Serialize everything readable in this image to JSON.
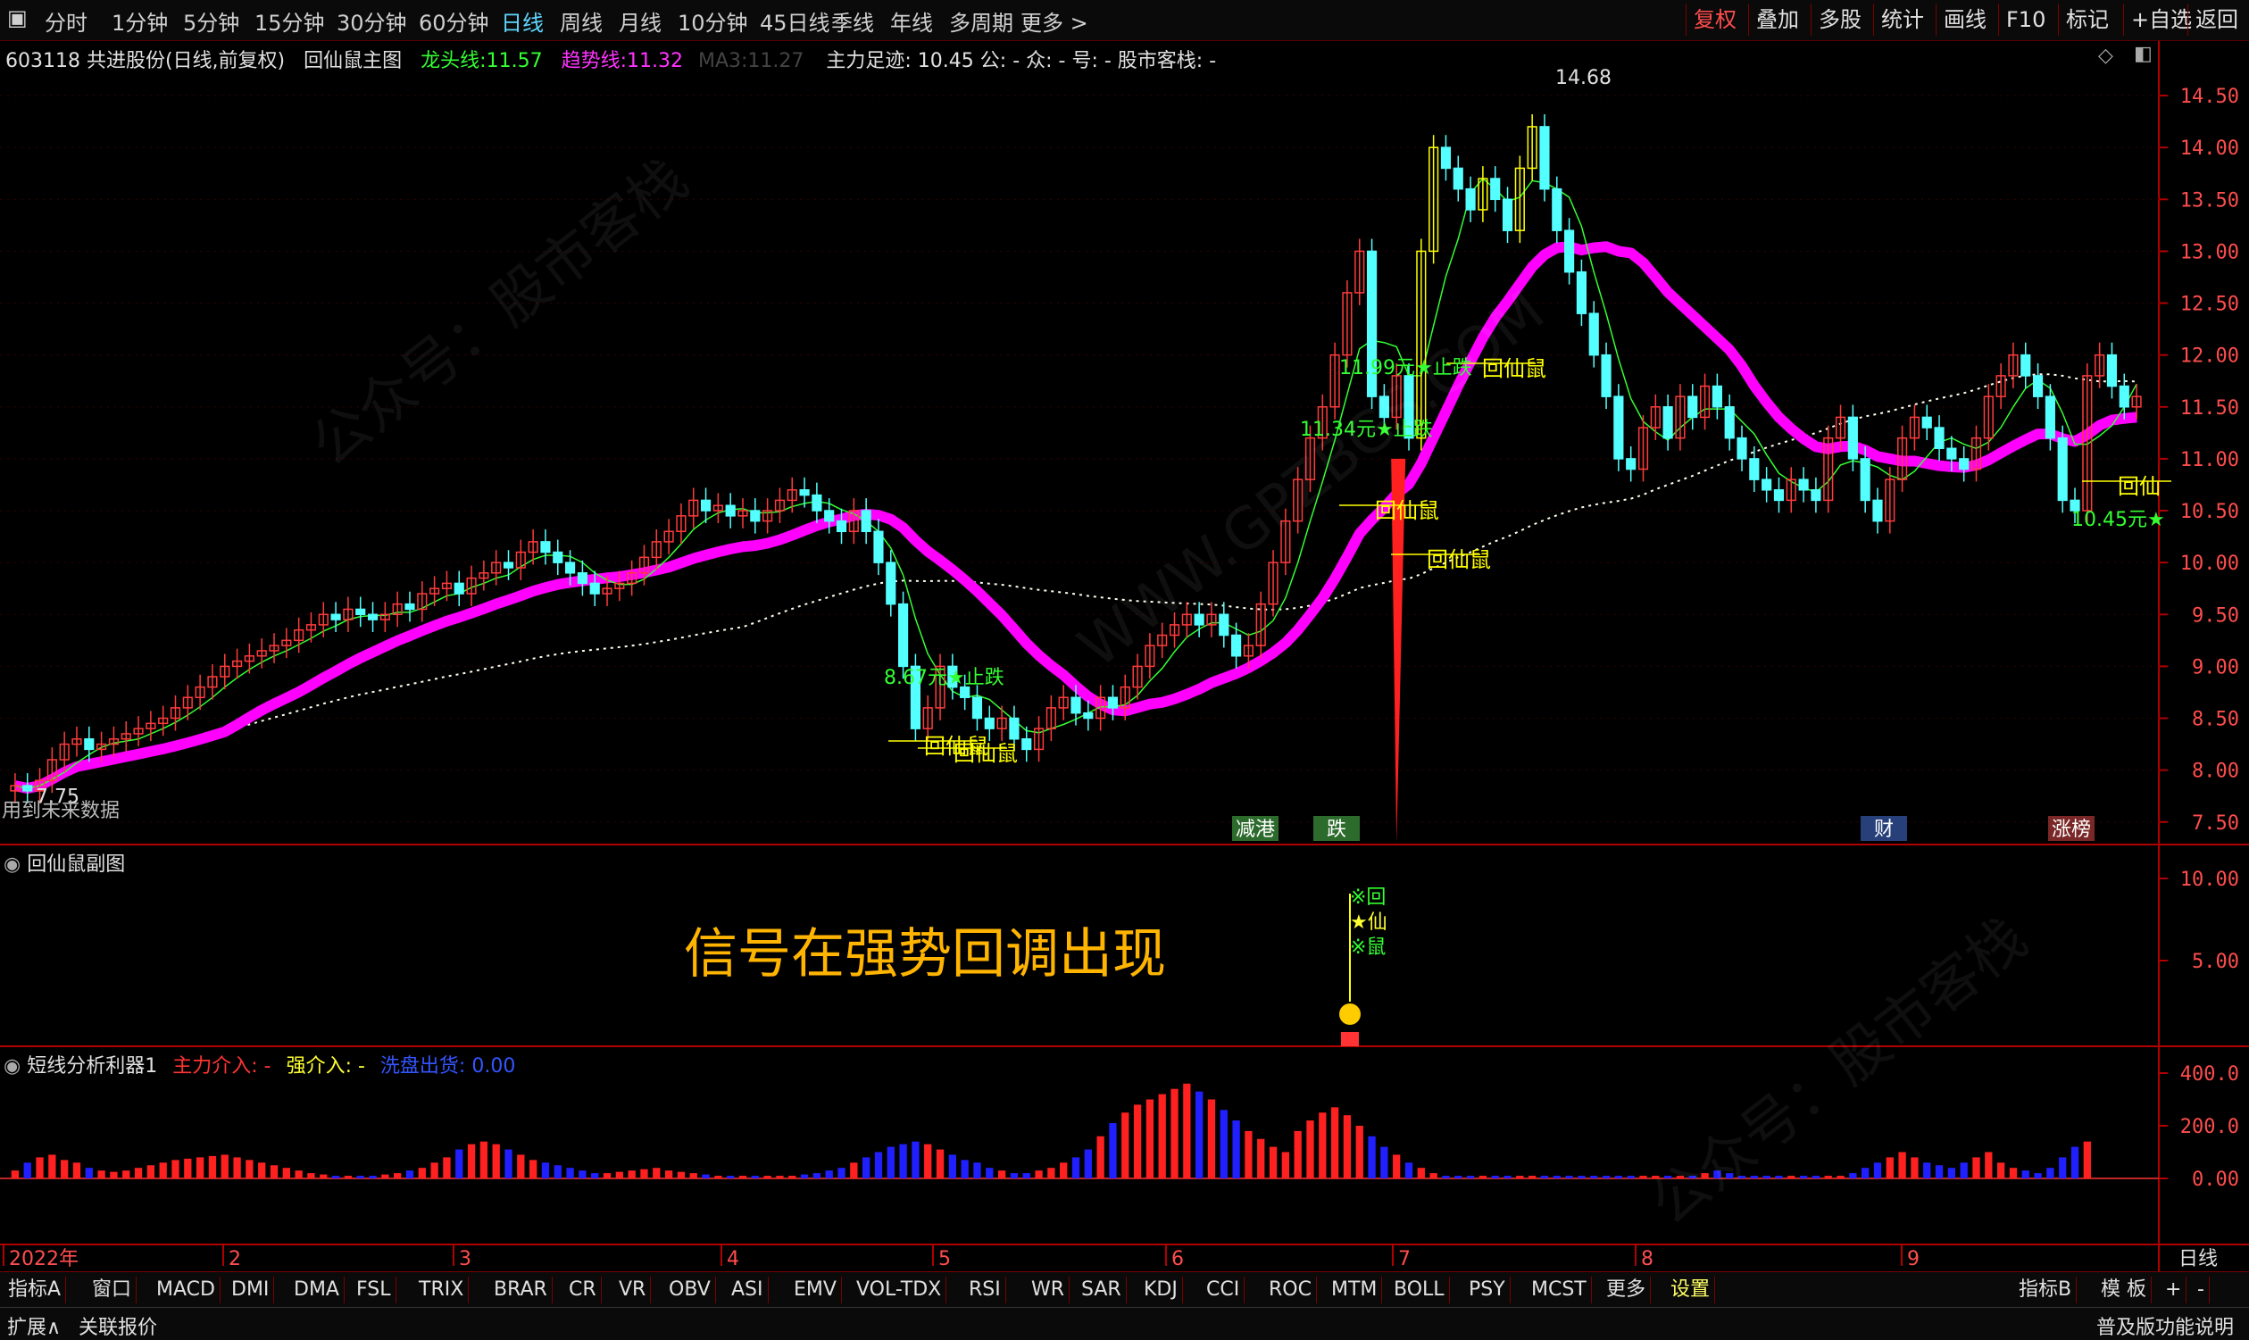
{
  "toolbar": {
    "periods": [
      "分时",
      "1分钟",
      "5分钟",
      "15分钟",
      "30分钟",
      "60分钟",
      "日线",
      "周线",
      "月线",
      "10分钟",
      "45日线",
      "季线",
      "年线",
      "多周期",
      "更多"
    ],
    "active_period": "日线",
    "right_tabs": [
      "复权",
      "叠加",
      "多股",
      "统计",
      "画线",
      "F10",
      "标记",
      "+自选",
      "返回"
    ]
  },
  "main_header": {
    "stock": "603118 共进股份(日线,前复权)",
    "indicator": "回仙鼠主图",
    "dragon_label": "龙头线:",
    "dragon_value": "11.57",
    "trend_label": "趋势线:",
    "trend_value": "11.32",
    "ma3_label": "MA3:",
    "ma3_value": "11.27",
    "footprint": "主力足迹: 10.45 公: - 众: - 号: - 股市客栈: -"
  },
  "sub1_header": {
    "title": "回仙鼠副图"
  },
  "sub2_header": {
    "title": "短线分析利器1",
    "main_in": "主力介入: -",
    "strong_in": "强介入: -",
    "wash": "洗盘出货: 0.00"
  },
  "annotation_note": "信号在强势回调出现",
  "future_note": "用到未来数据",
  "colors": {
    "up": "#ff3b3b",
    "down": "#54ffff",
    "yellow": "#ffff00",
    "magenta": "#ff00ff",
    "green": "#33ff33",
    "blue": "#1a1aff"
  },
  "chart_data": {
    "type": "candlestick",
    "x_months": [
      "2022年",
      "2",
      "3",
      "4",
      "5",
      "6",
      "7",
      "8",
      "9"
    ],
    "y_ticks": [
      7.5,
      8.0,
      8.5,
      9.0,
      9.5,
      10.0,
      10.5,
      11.0,
      11.5,
      12.0,
      12.5,
      13.0,
      13.5,
      14.0,
      14.5
    ],
    "ylim": [
      7.3,
      14.75
    ],
    "high_label": "14.68",
    "low_label": "7.75",
    "event_tags": [
      "减港",
      "跌",
      "财",
      "涨榜"
    ],
    "signal_labels": [
      "回仙鼠",
      "回仙鼠",
      "回仙鼠",
      "回仙鼠",
      "回仙鼠",
      "回仙"
    ],
    "stop_labels": [
      "8.67元★止跌",
      "11.99元★止跌",
      "11.34元★止跌",
      "10.45元★"
    ],
    "sub1_y_ticks": [
      5.0,
      10.0
    ],
    "sub1_signal": [
      "※回",
      "★仙",
      "※鼠"
    ],
    "sub2_y_ticks": [
      0.0,
      200.0,
      400.0
    ],
    "closes": [
      7.85,
      7.8,
      7.9,
      8.1,
      8.25,
      8.3,
      8.2,
      8.25,
      8.3,
      8.35,
      8.4,
      8.45,
      8.5,
      8.6,
      8.7,
      8.8,
      8.9,
      9.0,
      9.05,
      9.1,
      9.15,
      9.2,
      9.25,
      9.35,
      9.4,
      9.5,
      9.45,
      9.55,
      9.5,
      9.45,
      9.5,
      9.6,
      9.55,
      9.7,
      9.75,
      9.8,
      9.7,
      9.85,
      9.9,
      10.0,
      9.95,
      10.1,
      10.2,
      10.1,
      10.0,
      9.9,
      9.8,
      9.7,
      9.75,
      9.8,
      9.9,
      10.05,
      10.2,
      10.3,
      10.45,
      10.6,
      10.5,
      10.55,
      10.45,
      10.5,
      10.4,
      10.5,
      10.6,
      10.7,
      10.65,
      10.5,
      10.4,
      10.3,
      10.5,
      10.3,
      10.0,
      9.6,
      9.0,
      8.4,
      8.6,
      9.0,
      8.8,
      8.7,
      8.5,
      8.4,
      8.5,
      8.3,
      8.2,
      8.4,
      8.6,
      8.7,
      8.55,
      8.5,
      8.7,
      8.6,
      8.8,
      9.0,
      9.2,
      9.3,
      9.4,
      9.5,
      9.4,
      9.5,
      9.3,
      9.1,
      9.2,
      9.6,
      10.0,
      10.4,
      10.8,
      11.2,
      11.5,
      12.0,
      12.6,
      13.0,
      11.6,
      11.4,
      11.8,
      11.2,
      13.0,
      14.0,
      13.8,
      13.6,
      13.4,
      13.7,
      13.5,
      13.2,
      13.8,
      14.2,
      13.6,
      13.2,
      12.8,
      12.4,
      12.0,
      11.6,
      11.0,
      10.9,
      11.3,
      11.5,
      11.2,
      11.6,
      11.4,
      11.7,
      11.5,
      11.2,
      11.0,
      10.8,
      10.7,
      10.6,
      10.8,
      10.7,
      10.6,
      11.2,
      11.4,
      11.0,
      10.6,
      10.4,
      10.8,
      11.2,
      11.4,
      11.3,
      11.1,
      11.0,
      10.9,
      11.2,
      11.6,
      11.8,
      12.0,
      11.8,
      11.6,
      11.2,
      10.6,
      10.5,
      11.8,
      12.0,
      11.7,
      11.5,
      11.6
    ],
    "sub2_values": [
      30,
      60,
      80,
      90,
      70,
      60,
      40,
      30,
      25,
      30,
      40,
      50,
      60,
      70,
      75,
      80,
      85,
      90,
      80,
      70,
      60,
      50,
      40,
      30,
      20,
      15,
      10,
      10,
      10,
      10,
      15,
      20,
      30,
      40,
      60,
      80,
      110,
      130,
      140,
      130,
      110,
      90,
      70,
      60,
      50,
      40,
      30,
      20,
      20,
      25,
      30,
      35,
      40,
      30,
      25,
      20,
      15,
      10,
      10,
      10,
      10,
      10,
      10,
      10,
      15,
      20,
      30,
      40,
      60,
      80,
      100,
      120,
      130,
      140,
      130,
      110,
      90,
      70,
      60,
      40,
      30,
      20,
      20,
      30,
      40,
      60,
      80,
      110,
      160,
      210,
      250,
      280,
      300,
      320,
      340,
      360,
      330,
      300,
      260,
      220,
      180,
      150,
      120,
      100,
      180,
      220,
      250,
      270,
      240,
      200,
      160,
      120,
      90,
      60,
      40,
      20,
      10,
      10,
      10,
      10,
      10,
      10,
      10,
      10,
      10,
      10,
      10,
      10,
      10,
      10,
      10,
      10,
      10,
      10,
      10,
      10,
      10,
      20,
      30,
      20,
      10,
      10,
      10,
      10,
      10,
      10,
      10,
      10,
      10,
      20,
      40,
      60,
      80,
      100,
      80,
      60,
      50,
      40,
      60,
      80,
      100,
      60,
      40,
      30,
      20,
      40,
      80,
      120,
      140
    ]
  }
}
